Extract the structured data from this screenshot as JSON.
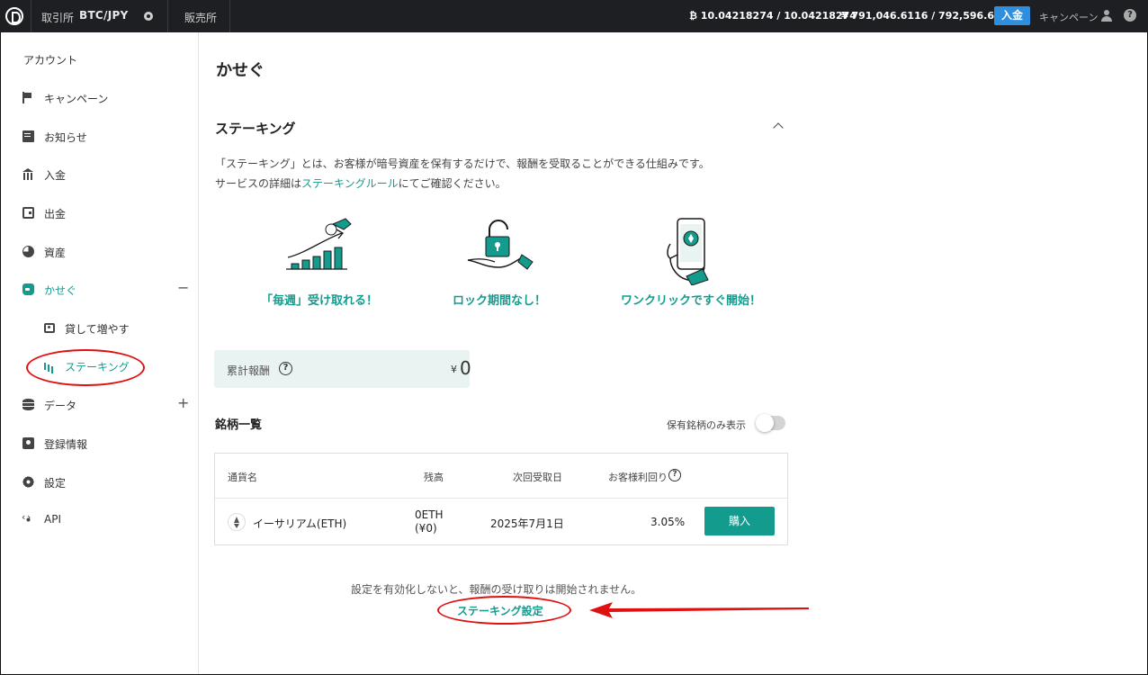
{
  "topbar": {
    "exchange_label": "取引所",
    "pair": "BTC/JPY",
    "shop_label": "販売所",
    "btc_balance": "₿ 10.04218274 / 10.04218274",
    "jpy_balance": "¥ 791,046.6116 / 792,596.6116",
    "deposit_button": "入金",
    "campaign_link": "キャンペーン",
    "help_glyph": "?"
  },
  "sidebar": {
    "header": "アカウント",
    "items": [
      {
        "label": "キャンペーン",
        "icon": "flag-icon"
      },
      {
        "label": "お知らせ",
        "icon": "message-icon"
      },
      {
        "label": "入金",
        "icon": "bank-icon"
      },
      {
        "label": "出金",
        "icon": "wallet-icon"
      },
      {
        "label": "資産",
        "icon": "pie-chart-icon"
      },
      {
        "label": "かせぐ",
        "icon": "money-bag-icon",
        "control": "−"
      },
      {
        "label": "データ",
        "icon": "database-icon",
        "control": "+"
      },
      {
        "label": "登録情報",
        "icon": "id-card-icon"
      },
      {
        "label": "設定",
        "icon": "gear-icon"
      },
      {
        "label": "API",
        "icon": "api-icon"
      }
    ],
    "subitems": [
      {
        "label": "貸して増やす",
        "icon": "cash-icon"
      },
      {
        "label": "ステーキング",
        "icon": "bar-chart-icon"
      }
    ]
  },
  "main": {
    "page_title": "かせぐ",
    "section_title": "ステーキング",
    "description_line1": "「ステーキング」とは、お客様が暗号資産を保有するだけで、報酬を受取ることができる仕組みです。",
    "description_line2_prefix": "サービスの詳細は",
    "description_link": "ステーキングルール",
    "description_line2_suffix": "にてご確認ください。",
    "features": [
      {
        "caption": "「毎週」受け取れる！",
        "icon": "growing-coins-icon"
      },
      {
        "caption": "ロック期間なし！",
        "icon": "unlocked-hand-icon"
      },
      {
        "caption": "ワンクリックですぐ開始！",
        "icon": "phone-click-icon"
      }
    ],
    "reward": {
      "label": "累計報酬",
      "help": "?",
      "currency": "¥",
      "value": "0"
    },
    "list_title": "銘柄一覧",
    "own_only_label": "保有銘柄のみ表示",
    "own_only_enabled": false,
    "table": {
      "headers": [
        "通貨名",
        "残高",
        "次回受取日",
        "お客様利回り"
      ],
      "rows": [
        {
          "name": "イーサリアム(ETH)",
          "balance": "0ETH",
          "balance_jpy": "(¥0)",
          "next_date": "2025年7月1日",
          "yield": "3.05%",
          "action": "購入"
        }
      ]
    },
    "notice": "設定を有効化しないと、報酬の受け取りは開始されません。",
    "setting_link": "ステーキング設定"
  },
  "colors": {
    "accent": "#139b8e",
    "topbar": "#1e1f23",
    "deposit": "#2f8fde",
    "annotation": "#e01010"
  }
}
